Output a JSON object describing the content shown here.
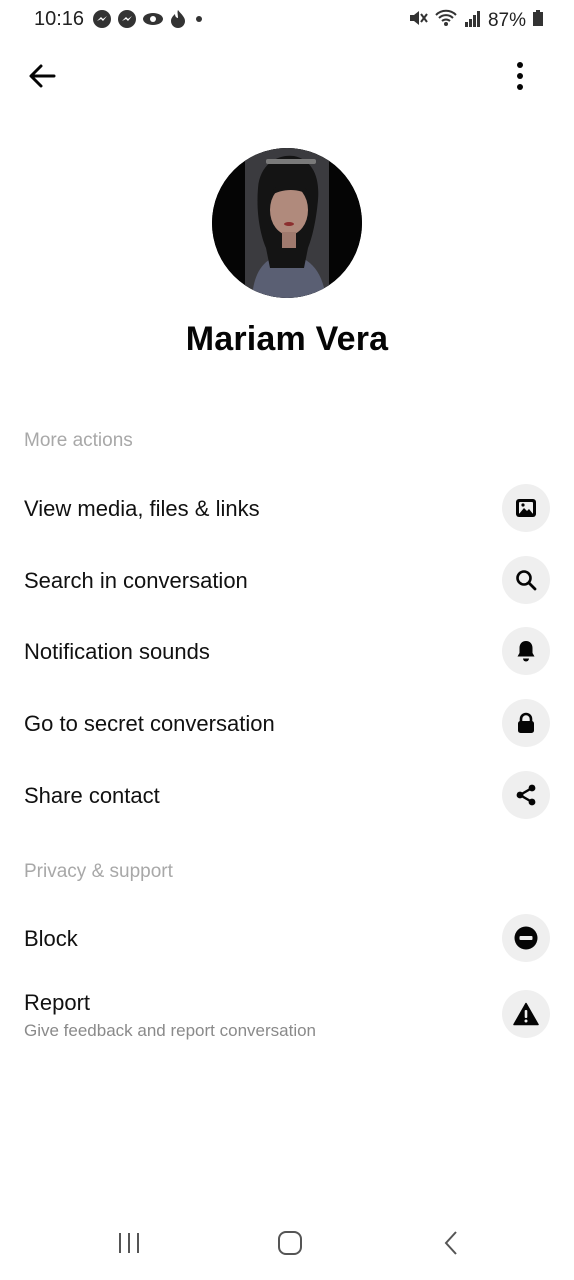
{
  "status_bar": {
    "time": "10:16",
    "notification_icons": [
      "messenger-icon",
      "messenger-icon",
      "eye-icon",
      "flame-icon",
      "dot-icon"
    ],
    "battery": "87%",
    "status_icons": [
      "mute-icon",
      "wifi-icon",
      "signal-icon",
      "battery-icon"
    ]
  },
  "header": {
    "back_icon": "arrow-left-icon",
    "more_icon": "more-vertical-icon"
  },
  "profile": {
    "name": "Mariam Vera"
  },
  "more_actions": {
    "header": "More actions",
    "items": [
      {
        "label": "View media, files & links",
        "icon": "image-icon"
      },
      {
        "label": "Search in conversation",
        "icon": "search-icon"
      },
      {
        "label": "Notification sounds",
        "icon": "bell-icon"
      },
      {
        "label": "Go to secret conversation",
        "icon": "lock-icon"
      },
      {
        "label": "Share contact",
        "icon": "share-icon"
      }
    ]
  },
  "privacy_support": {
    "header": "Privacy & support",
    "items": [
      {
        "label": "Block",
        "icon": "block-icon"
      },
      {
        "label": "Report",
        "sublabel": "Give feedback and report conversation",
        "icon": "warning-icon"
      }
    ]
  },
  "nav_bar": {
    "items": [
      "recents-icon",
      "home-icon",
      "back-chevron-icon"
    ]
  }
}
